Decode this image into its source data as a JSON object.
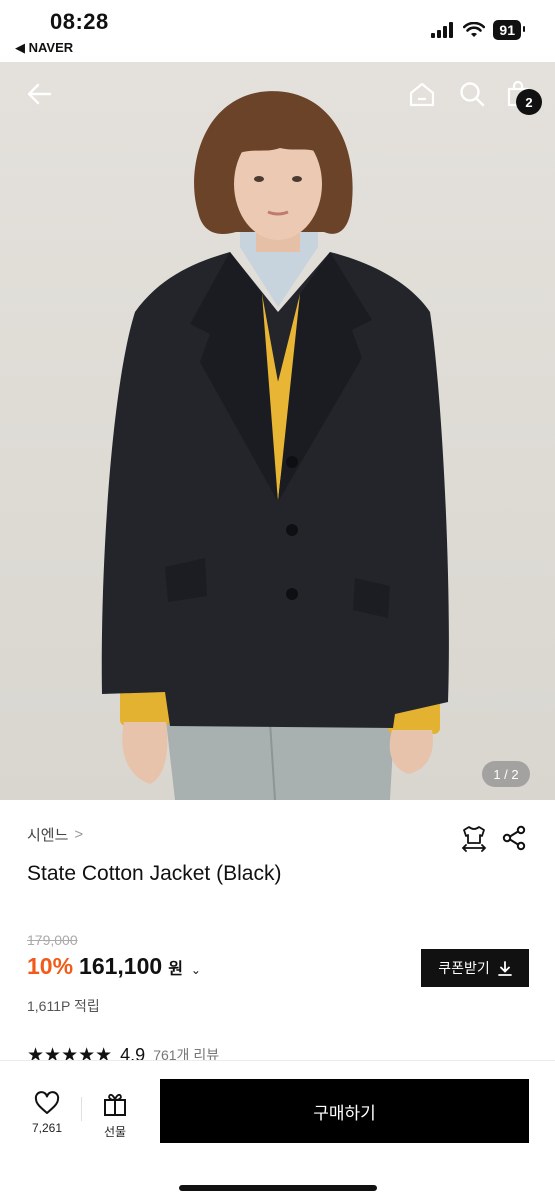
{
  "status_bar": {
    "time": "08:28",
    "back_app": "◀ NAVER",
    "battery": "91"
  },
  "hero": {
    "counter": "1 / 2",
    "cart_count": "2"
  },
  "product": {
    "brand": "시엔느",
    "title": "State Cotton Jacket (Black)",
    "original_price": "179,000",
    "discount": "10%",
    "price": "161,100",
    "currency": "원",
    "coupon_label": "쿠폰받기",
    "points": "1,611P 적립",
    "stars": "★★★★★",
    "rating": "4.9",
    "review_count": "761개 리뷰"
  },
  "bottom_bar": {
    "wish_count": "7,261",
    "gift_label": "선물",
    "buy_label": "구매하기"
  },
  "colors": {
    "accent": "#f25a1a",
    "primary": "#000000"
  },
  "icons": [
    "back-arrow-icon",
    "home-icon",
    "search-icon",
    "shopping-bag-icon",
    "size-guide-icon",
    "share-icon",
    "download-icon",
    "heart-icon",
    "gift-icon"
  ]
}
